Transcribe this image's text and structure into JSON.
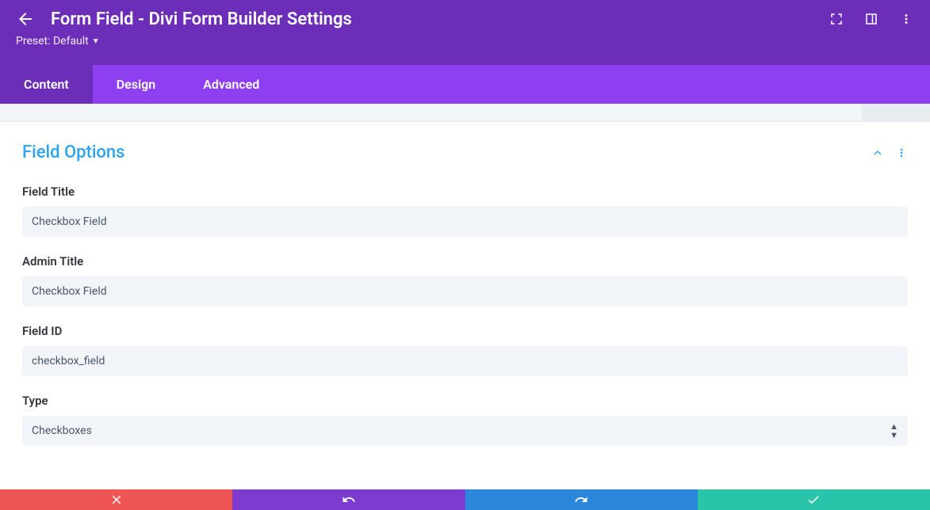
{
  "header": {
    "title": "Form Field - Divi Form Builder Settings",
    "preset_label": "Preset: Default"
  },
  "tabs": [
    {
      "label": "Content",
      "active": true
    },
    {
      "label": "Design",
      "active": false
    },
    {
      "label": "Advanced",
      "active": false
    }
  ],
  "section": {
    "title": "Field Options"
  },
  "fields": {
    "field_title": {
      "label": "Field Title",
      "value": "Checkbox Field"
    },
    "admin_title": {
      "label": "Admin Title",
      "value": "Checkbox Field"
    },
    "field_id": {
      "label": "Field ID",
      "value": "checkbox_field"
    },
    "type": {
      "label": "Type",
      "value": "Checkboxes"
    }
  }
}
